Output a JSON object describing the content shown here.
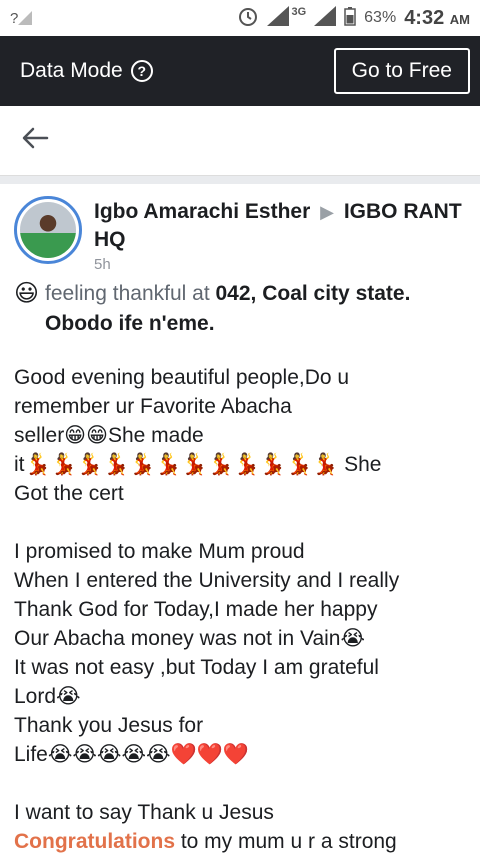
{
  "status": {
    "signal_left": "?",
    "network": "3G",
    "battery": "63%",
    "time": "4:32",
    "ampm": "AM"
  },
  "data_bar": {
    "label": "Data Mode",
    "help_icon": "?",
    "cta": "Go to Free"
  },
  "post": {
    "author": "Igbo Amarachi Esther",
    "arrow": "▶",
    "group": "IGBO RANT HQ",
    "time": "5h",
    "feeling_emoji": "😃",
    "feeling_text": "feeling thankful at",
    "place": "042, Coal city state. Obodo ife n'eme.",
    "lines": [
      "Good evening beautiful people,Do u",
      "remember ur  Favorite Abacha",
      "seller😁😁She made",
      "it💃💃💃💃💃💃💃💃💃💃💃💃 She",
      "Got the cert",
      "",
      "I promised to make Mum proud",
      "When I entered the University and I really",
      "Thank God for Today,I made her happy",
      "Our Abacha money was not in Vain😭",
      "It was not easy ,but Today I am grateful",
      "Lord😭",
      "Thank you Jesus for",
      "Life😭😭😭😭😭❤️❤️❤️",
      "",
      "I want to say Thank u Jesus"
    ],
    "last_link": "Congratulations",
    "last_rest": " to my mum u r a strong"
  }
}
